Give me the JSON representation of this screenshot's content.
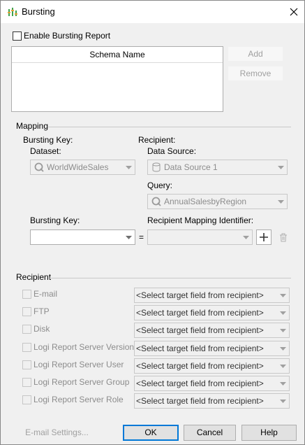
{
  "window": {
    "title": "Bursting",
    "icon": "bursting-bars-icon",
    "close_icon": "close-icon"
  },
  "enable_bursting": {
    "label": "Enable Bursting Report",
    "checked": false
  },
  "schema_table": {
    "header": "Schema Name",
    "rows": []
  },
  "schema_buttons": {
    "add": "Add",
    "remove": "Remove"
  },
  "mapping": {
    "group_label": "Mapping",
    "bursting_key_heading": "Bursting Key:",
    "dataset_label": "Dataset:",
    "dataset_value": "WorldWideSales",
    "dataset_icon": "query-q-icon",
    "recipient_heading": "Recipient:",
    "data_source_label": "Data Source:",
    "data_source_value": "Data Source 1",
    "data_source_icon": "database-icon",
    "query_label": "Query:",
    "query_value": "AnnualSalesbyRegion",
    "query_icon": "query-q-icon",
    "bursting_key_label": "Bursting Key:",
    "bursting_key_value": "",
    "recipient_mapping_label": "Recipient Mapping Identifier:",
    "recipient_mapping_value": "",
    "equals": "=",
    "add_icon": "plus-icon",
    "delete_icon": "trash-icon"
  },
  "recipient": {
    "group_label": "Recipient",
    "items": [
      {
        "label": "E-mail",
        "placeholder": "<Select target field from recipient>"
      },
      {
        "label": "FTP",
        "placeholder": "<Select target field from recipient>"
      },
      {
        "label": "Disk",
        "placeholder": "<Select target field from recipient>"
      },
      {
        "label": "Logi Report Server Version",
        "placeholder": "<Select target field from recipient>"
      },
      {
        "label": "Logi Report Server User",
        "placeholder": "<Select target field from recipient>"
      },
      {
        "label": "Logi Report Server Group",
        "placeholder": "<Select target field from recipient>"
      },
      {
        "label": "Logi Report Server Role",
        "placeholder": "<Select target field from recipient>"
      }
    ]
  },
  "footer": {
    "email_settings": "E-mail Settings...",
    "ok": "OK",
    "cancel": "Cancel",
    "help": "Help"
  },
  "colors": {
    "accent": "#0078d7",
    "title_icon": "#3fa34d",
    "disabled_text": "#8c8c8c"
  }
}
